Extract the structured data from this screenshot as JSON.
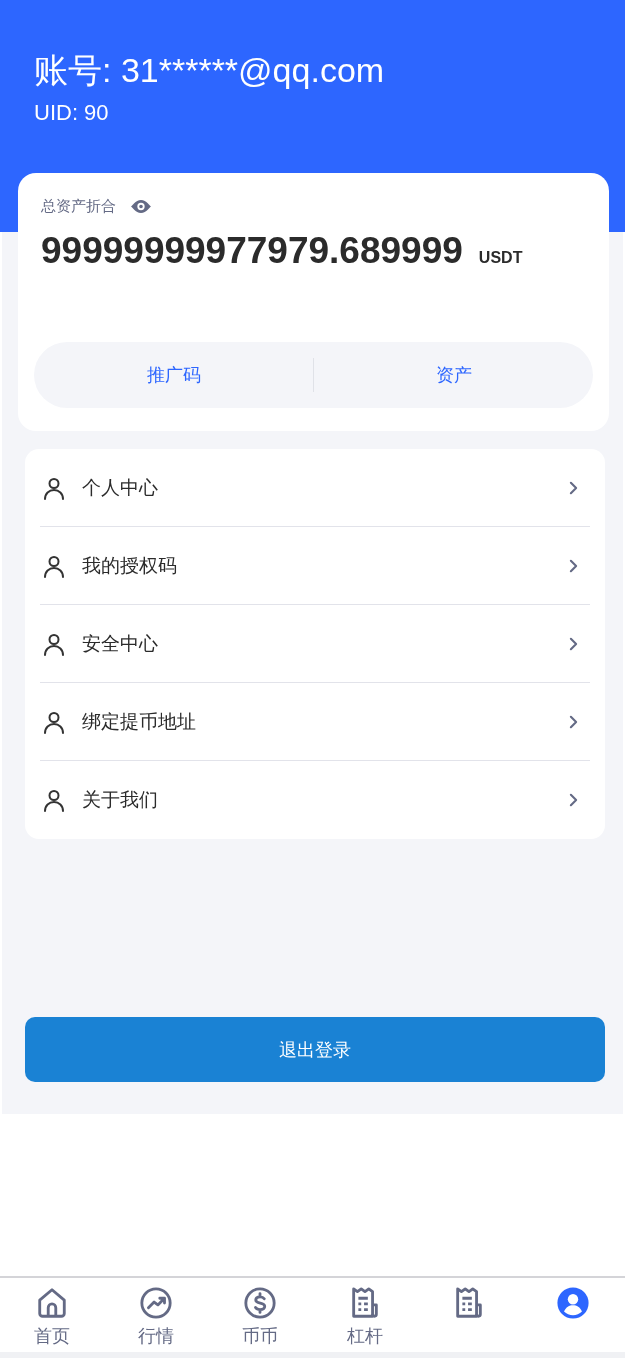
{
  "header": {
    "account": "账号: 31******@qq.com",
    "uid": "UID: 90"
  },
  "assets": {
    "label": "总资产折合",
    "amount": "99999999977979.689999",
    "unit": "USDT",
    "actions": [
      "推广码",
      "资产"
    ]
  },
  "menu": [
    {
      "label": "个人中心"
    },
    {
      "label": "我的授权码"
    },
    {
      "label": "安全中心"
    },
    {
      "label": "绑定提币地址"
    },
    {
      "label": "关于我们"
    }
  ],
  "logout": "退出登录",
  "tab_bar": [
    {
      "kind": "home",
      "label": "首页",
      "selected": false
    },
    {
      "kind": "chart",
      "label": "行情",
      "selected": false
    },
    {
      "kind": "dollar",
      "label": "币币",
      "selected": false
    },
    {
      "kind": "receipt",
      "label": "杠杆",
      "selected": false
    },
    {
      "kind": "receipt",
      "selected": false
    },
    {
      "kind": "user",
      "selected": true
    }
  ]
}
